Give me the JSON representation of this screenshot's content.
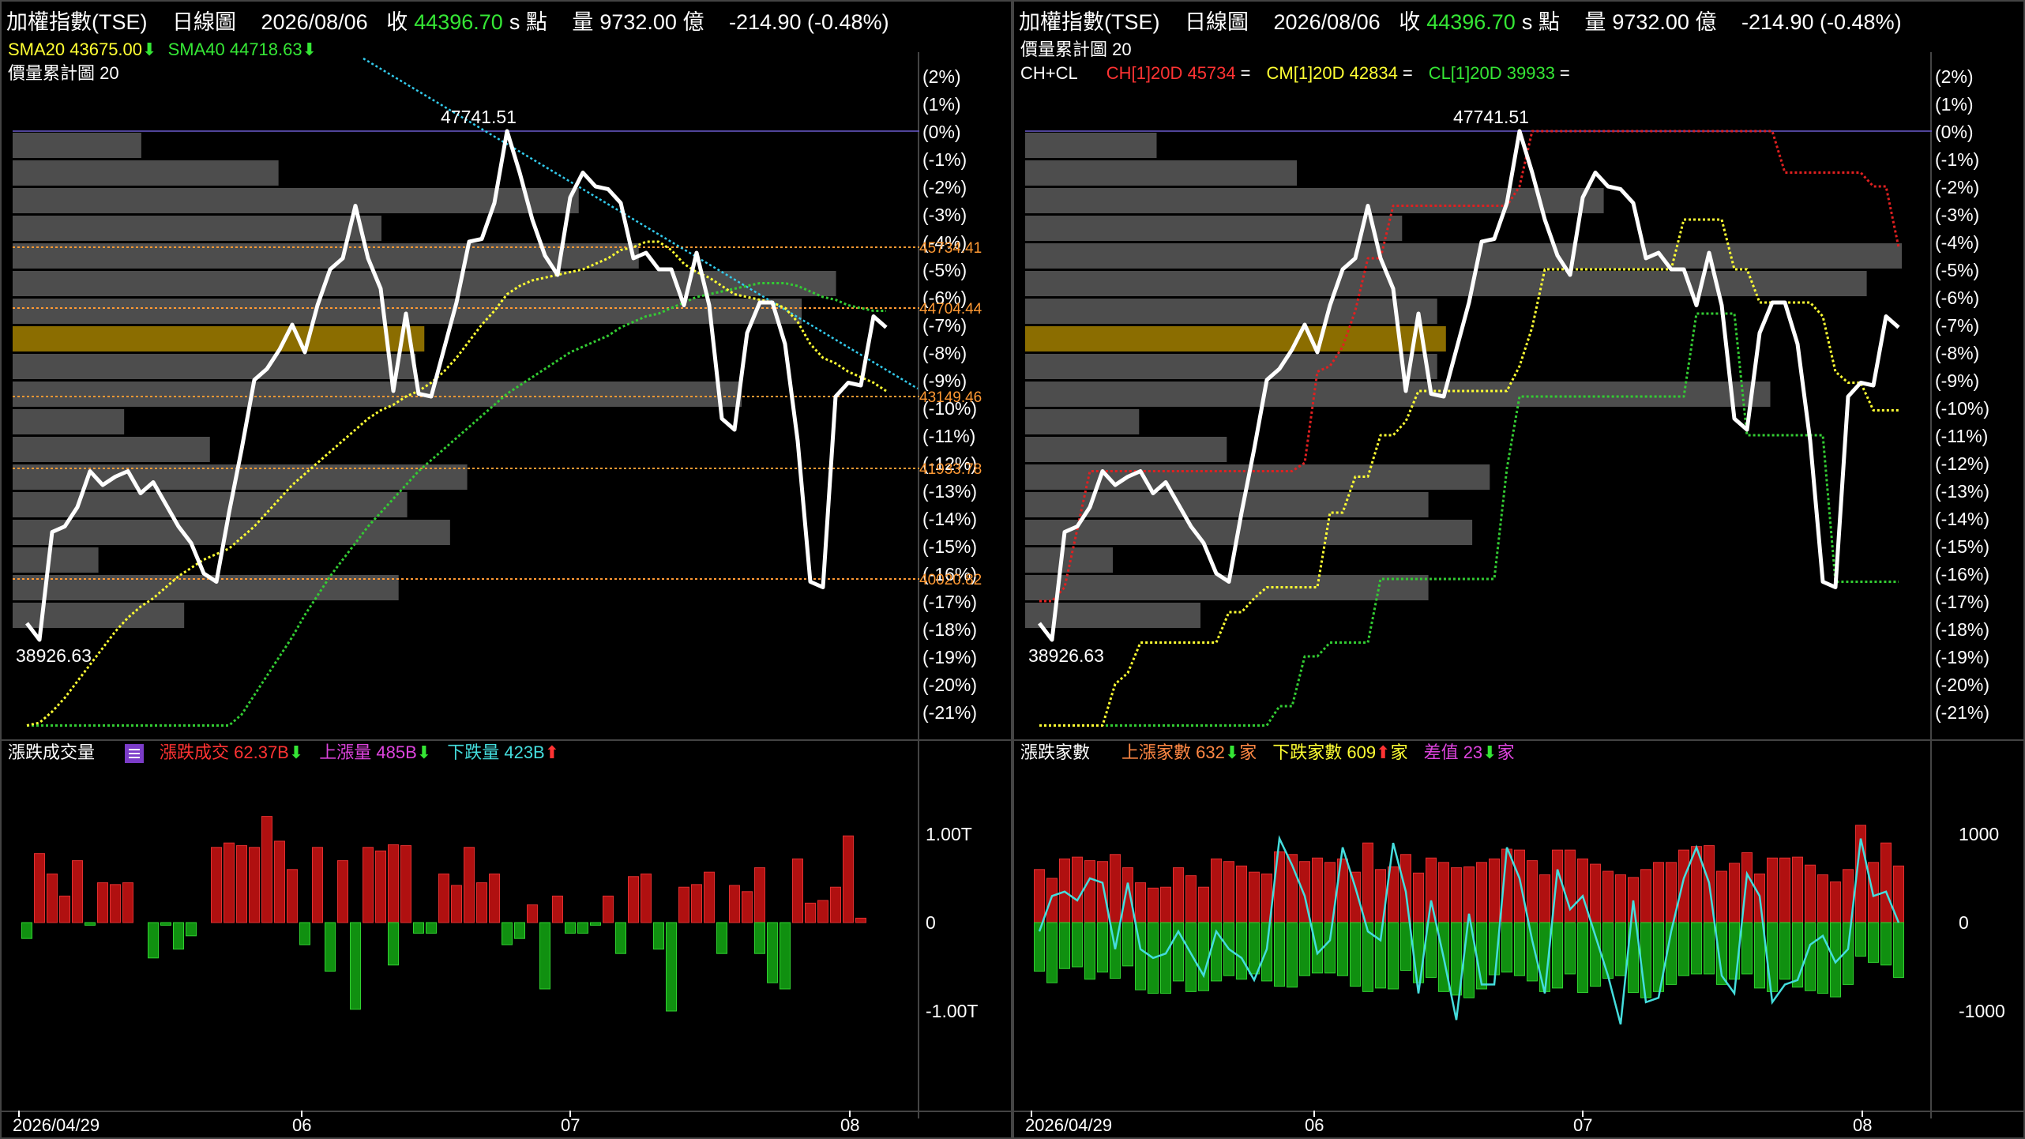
{
  "left": {
    "header": {
      "name": "加權指數(TSE)",
      "period": "日線圖",
      "date": "2026/08/06",
      "close_label": "收",
      "close": "44396.70",
      "unit": "s 點",
      "vol_label": "量",
      "volume": "9732.00 億",
      "change": "-214.90 (-0.48%)"
    },
    "legend": {
      "sma20": "SMA20 43675.00",
      "sma20_arrow": "⬇",
      "sma40": "SMA40 44718.63",
      "sma40_arrow": "⬇",
      "profile": "價量累計圖 20"
    },
    "lower_legend": {
      "title": "漲跌成交量",
      "a": "漲跌成交 62.37B",
      "a_arrow": "⬇",
      "b": "上漲量 485B",
      "b_arrow": "⬇",
      "c": "下跌量 423B",
      "c_arrow": "⬆"
    },
    "levels": [
      "45734.41",
      "44704.44",
      "43149.46",
      "41933.78",
      "40020.82"
    ],
    "lower_ticks": [
      "1.00T",
      "0",
      "-1.00T"
    ]
  },
  "right": {
    "header": {
      "name": "加權指數(TSE)",
      "period": "日線圖",
      "date": "2026/08/06",
      "close_label": "收",
      "close": "44396.70",
      "unit": "s 點",
      "vol_label": "量",
      "volume": "9732.00 億",
      "change": "-214.90 (-0.48%)"
    },
    "legend": {
      "profile": "價量累計圖 20",
      "chcl": "CH+CL",
      "ch": "CH[1]20D 45734",
      "cm": "CM[1]20D 42834",
      "cl": "CL[1]20D 39933",
      "eq": "="
    },
    "lower_legend": {
      "title": "漲跌家數",
      "a": "上漲家數 632",
      "a_arrow": "⬇",
      "a_unit": "家",
      "b": "下跌家數 609",
      "b_arrow": "⬆",
      "b_unit": "家",
      "c": "差值 23",
      "c_arrow": "⬇",
      "c_unit": "家"
    },
    "lower_ticks": [
      "1000",
      "0",
      "-1000"
    ]
  },
  "colors": {
    "price": "#ffffff",
    "sma20": "#ffff33",
    "sma40": "#33cc33",
    "trend": "#33ccee",
    "level": "#ff9933",
    "profile": "#4d4d4d",
    "poc": "#8b6d00",
    "ch": "#e02020",
    "cm": "#ffff33",
    "cl": "#33cc33",
    "up": "#b01010",
    "down": "#109010",
    "diff": "#44dddd"
  },
  "chart_data": [
    {
      "type": "line",
      "panel": "left",
      "x_ticks": [
        "2026/04/29",
        "06",
        "07",
        "08"
      ],
      "y_ticks": [
        "(2%)",
        "(1%)",
        "(0%)",
        "(-1%)",
        "(-2%)",
        "(-3%)",
        "(-4%)",
        "(-5%)",
        "(-6%)",
        "(-7%)",
        "(-8%)",
        "(-9%)",
        "(-10%)",
        "(-11%)",
        "(-12%)",
        "(-13%)",
        "(-14%)",
        "(-15%)",
        "(-16%)",
        "(-17%)",
        "(-18%)",
        "(-19%)",
        "(-20%)",
        "(-21%)"
      ],
      "ylim_pct": [
        -21.5,
        2.5
      ],
      "high_label": "47741.51",
      "low_label": "38926.63",
      "series": [
        {
          "name": "加權指數(TSE)",
          "values": [
            -17.8,
            -18.4,
            -14.5,
            -14.3,
            -13.6,
            -12.3,
            -12.8,
            -12.5,
            -12.3,
            -13.1,
            -12.7,
            -13.5,
            -14.3,
            -14.9,
            -16.0,
            -16.3,
            -13.8,
            -11.5,
            -9.0,
            -8.6,
            -7.9,
            -7.0,
            -8.0,
            -6.3,
            -5.0,
            -4.6,
            -2.7,
            -4.6,
            -5.7,
            -9.4,
            -6.6,
            -9.5,
            -9.6,
            -7.9,
            -6.2,
            -4.0,
            -3.9,
            -2.6,
            -0.0,
            -1.5,
            -3.2,
            -4.5,
            -5.2,
            -2.4,
            -1.5,
            -2.0,
            -2.1,
            -2.6,
            -4.6,
            -4.4,
            -5.0,
            -5.0,
            -6.3,
            -4.4,
            -6.3,
            -10.4,
            -10.8,
            -7.3,
            -6.2,
            -6.2,
            -7.7,
            -11.2,
            -16.3,
            -16.5,
            -9.6,
            -9.1,
            -9.2,
            -6.7,
            -7.1
          ]
        },
        {
          "name": "SMA20",
          "values": [
            -21.5,
            -21.4,
            -21.0,
            -20.5,
            -19.9,
            -19.3,
            -18.7,
            -18.1,
            -17.6,
            -17.2,
            -16.9,
            -16.5,
            -16.1,
            -15.8,
            -15.5,
            -15.3,
            -15.1,
            -14.7,
            -14.3,
            -13.8,
            -13.3,
            -12.8,
            -12.4,
            -12.0,
            -11.6,
            -11.2,
            -10.8,
            -10.4,
            -10.1,
            -9.9,
            -9.6,
            -9.4,
            -9.1,
            -8.7,
            -8.2,
            -7.6,
            -7.0,
            -6.5,
            -5.9,
            -5.6,
            -5.4,
            -5.3,
            -5.2,
            -5.1,
            -5.0,
            -4.8,
            -4.6,
            -4.3,
            -4.2,
            -4.0,
            -4.0,
            -4.3,
            -4.8,
            -5.1,
            -5.3,
            -5.6,
            -5.9,
            -6.0,
            -6.1,
            -6.2,
            -6.4,
            -6.9,
            -7.7,
            -8.2,
            -8.4,
            -8.7,
            -8.9,
            -9.1,
            -9.4
          ]
        },
        {
          "name": "SMA40",
          "values": [
            -21.5,
            -21.5,
            -21.5,
            -21.5,
            -21.5,
            -21.5,
            -21.5,
            -21.5,
            -21.5,
            -21.5,
            -21.5,
            -21.5,
            -21.5,
            -21.5,
            -21.5,
            -21.5,
            -21.5,
            -21.1,
            -20.4,
            -19.7,
            -19.0,
            -18.3,
            -17.5,
            -16.8,
            -16.1,
            -15.5,
            -14.9,
            -14.3,
            -13.8,
            -13.3,
            -12.8,
            -12.3,
            -11.9,
            -11.5,
            -11.1,
            -10.7,
            -10.3,
            -9.9,
            -9.5,
            -9.2,
            -8.9,
            -8.6,
            -8.3,
            -8.0,
            -7.8,
            -7.6,
            -7.4,
            -7.1,
            -6.9,
            -6.7,
            -6.6,
            -6.4,
            -6.2,
            -6.0,
            -5.9,
            -5.8,
            -5.7,
            -5.6,
            -5.5,
            -5.5,
            -5.5,
            -5.6,
            -5.8,
            -6.0,
            -6.1,
            -6.3,
            -6.4,
            -6.5,
            -6.5
          ]
        }
      ],
      "price_levels": [
        45734.41,
        44704.44,
        43149.46,
        41933.78,
        40020.82
      ],
      "level_pct": [
        -4.2,
        -6.4,
        -9.6,
        -12.2,
        -16.2
      ],
      "trendline_pct": [
        [
          35,
          -1.6
        ],
        [
          68,
          -9.2
        ]
      ],
      "profile_bands_pct": [
        [
          0.0,
          -1.0
        ],
        [
          -1.0,
          -2.0
        ],
        [
          -2.0,
          -3.0
        ],
        [
          -3.0,
          -4.0
        ],
        [
          -4.0,
          -5.0
        ],
        [
          -5.0,
          -6.0
        ],
        [
          -6.0,
          -7.0
        ],
        [
          -7.0,
          -8.0
        ],
        [
          -8.0,
          -9.0
        ],
        [
          -9.0,
          -10.0
        ],
        [
          -10.0,
          -11.0
        ],
        [
          -11.0,
          -12.0
        ],
        [
          -12.0,
          -13.0
        ],
        [
          -13.0,
          -14.0
        ],
        [
          -14.0,
          -15.0
        ],
        [
          -15.0,
          -16.0
        ],
        [
          -16.0,
          -17.0
        ],
        [
          -17.0,
          -18.0
        ]
      ],
      "profile_widths": [
        0.15,
        0.31,
        0.66,
        0.43,
        0.73,
        0.96,
        0.92,
        0.48,
        0.47,
        0.85,
        0.13,
        0.23,
        0.53,
        0.46,
        0.51,
        0.1,
        0.45,
        0.2
      ],
      "profile_poc_index": 7
    },
    {
      "type": "bar",
      "panel": "left",
      "name": "漲跌成交量",
      "ylim": [
        -1.35,
        1.35
      ],
      "up": [
        0,
        0.78,
        0.55,
        0.3,
        0.7,
        0,
        0.45,
        0.43,
        0.45,
        0,
        0,
        0,
        0,
        0,
        0,
        0.85,
        0.9,
        0.87,
        0.85,
        1.2,
        0.92,
        0.6,
        0,
        0.85,
        0,
        0.7,
        0,
        0.85,
        0.81,
        0.88,
        0.87,
        0,
        0,
        0.55,
        0.42,
        0.85,
        0.45,
        0.55,
        0,
        0,
        0.2,
        0,
        0.3,
        0,
        0,
        0,
        0.3,
        0,
        0.52,
        0.55,
        0,
        0,
        0.4,
        0.43,
        0.57,
        0,
        0.42,
        0.35,
        0.62,
        0,
        0,
        0.72,
        0.22,
        0.25,
        0.4,
        0.98,
        0.05,
        0,
        0
      ],
      "down": [
        0.18,
        0,
        0,
        0,
        0,
        0.03,
        0,
        0,
        0,
        0,
        0.4,
        0.03,
        0.3,
        0.15,
        0,
        0,
        0,
        0,
        0,
        0,
        0,
        0,
        0.25,
        0,
        0.55,
        0,
        0.98,
        0,
        0,
        0.48,
        0,
        0.12,
        0.12,
        0,
        0,
        0,
        0,
        0,
        0.25,
        0.18,
        0,
        0.75,
        0,
        0.12,
        0.12,
        0.03,
        0,
        0.35,
        0,
        0,
        0.3,
        1.0,
        0,
        0,
        0,
        0.35,
        0,
        0,
        0.35,
        0.68,
        0.75,
        0,
        0,
        0,
        0,
        0,
        0,
        0,
        0
      ]
    },
    {
      "type": "line",
      "panel": "right",
      "series": [
        {
          "name": "CH[1]20D",
          "values": [
            -17.0,
            -17.0,
            -16.5,
            -14.4,
            -12.3,
            -12.3,
            -12.3,
            -12.3,
            -12.3,
            -12.3,
            -12.3,
            -12.3,
            -12.3,
            -12.3,
            -12.3,
            -12.3,
            -12.3,
            -12.3,
            -12.3,
            -12.3,
            -12.3,
            -12.0,
            -8.7,
            -8.5,
            -7.8,
            -6.5,
            -4.6,
            -4.6,
            -2.7,
            -2.7,
            -2.7,
            -2.7,
            -2.7,
            -2.7,
            -2.7,
            -2.7,
            -2.7,
            -2.7,
            -2.0,
            0.0,
            0.0,
            0.0,
            0.0,
            0.0,
            0.0,
            0.0,
            0.0,
            0.0,
            0.0,
            0.0,
            0.0,
            0.0,
            0.0,
            0.0,
            0.0,
            0.0,
            0.0,
            0.0,
            0.0,
            -1.5,
            -1.5,
            -1.5,
            -1.5,
            -1.5,
            -1.5,
            -1.5,
            -2.0,
            -2.0,
            -4.2
          ]
        },
        {
          "name": "CM[1]20D",
          "values": [
            -21.5,
            -21.5,
            -21.5,
            -21.5,
            -21.5,
            -21.5,
            -20.0,
            -19.6,
            -18.5,
            -18.5,
            -18.5,
            -18.5,
            -18.5,
            -18.5,
            -18.5,
            -17.4,
            -17.4,
            -16.9,
            -16.5,
            -16.5,
            -16.5,
            -16.5,
            -16.5,
            -13.8,
            -13.8,
            -12.5,
            -12.5,
            -11.0,
            -11.0,
            -10.5,
            -9.4,
            -9.4,
            -9.4,
            -9.4,
            -9.4,
            -9.4,
            -9.4,
            -9.4,
            -8.5,
            -7.1,
            -5.0,
            -5.0,
            -5.0,
            -5.0,
            -5.0,
            -5.0,
            -5.0,
            -5.0,
            -5.0,
            -5.0,
            -5.0,
            -3.2,
            -3.2,
            -3.2,
            -3.2,
            -5.0,
            -5.0,
            -6.2,
            -6.2,
            -6.2,
            -6.2,
            -6.2,
            -6.7,
            -8.7,
            -9.1,
            -9.1,
            -10.1,
            -10.1,
            -10.1
          ]
        },
        {
          "name": "CL[1]20D",
          "values": [
            -21.5,
            -21.5,
            -21.5,
            -21.5,
            -21.5,
            -21.5,
            -21.5,
            -21.5,
            -21.5,
            -21.5,
            -21.5,
            -21.5,
            -21.5,
            -21.5,
            -21.5,
            -21.5,
            -21.5,
            -21.5,
            -21.5,
            -20.8,
            -20.8,
            -19.0,
            -19.0,
            -18.5,
            -18.5,
            -18.5,
            -18.5,
            -16.2,
            -16.2,
            -16.2,
            -16.2,
            -16.2,
            -16.2,
            -16.2,
            -16.2,
            -16.2,
            -16.2,
            -12.2,
            -9.6,
            -9.6,
            -9.6,
            -9.6,
            -9.6,
            -9.6,
            -9.6,
            -9.6,
            -9.6,
            -9.6,
            -9.6,
            -9.6,
            -9.6,
            -9.6,
            -6.6,
            -6.6,
            -6.6,
            -6.6,
            -11.0,
            -11.0,
            -11.0,
            -11.0,
            -11.0,
            -11.0,
            -11.0,
            -16.3,
            -16.3,
            -16.3,
            -16.3,
            -16.3,
            -16.3
          ]
        }
      ],
      "profile_widths": [
        0.15,
        0.31,
        0.66,
        0.43,
        1.0,
        0.96,
        0.47,
        0.48,
        0.47,
        0.85,
        0.13,
        0.23,
        0.53,
        0.46,
        0.51,
        0.1,
        0.46,
        0.2
      ],
      "profile_poc_index": 7
    },
    {
      "type": "bar",
      "panel": "right",
      "name": "漲跌家數",
      "ylim": [
        -1250,
        1250
      ],
      "up": [
        600,
        500,
        720,
        740,
        700,
        690,
        770,
        620,
        450,
        390,
        400,
        620,
        530,
        400,
        720,
        690,
        640,
        570,
        550,
        800,
        770,
        690,
        730,
        680,
        720,
        570,
        900,
        600,
        630,
        770,
        560,
        730,
        680,
        620,
        630,
        680,
        720,
        830,
        820,
        700,
        540,
        820,
        820,
        720,
        660,
        580,
        540,
        510,
        600,
        680,
        680,
        820,
        860,
        870,
        580,
        670,
        790,
        550,
        730,
        730,
        740,
        650,
        540,
        460,
        600,
        1100,
        680,
        900,
        640
      ],
      "down": [
        550,
        680,
        520,
        500,
        640,
        560,
        630,
        490,
        760,
        800,
        800,
        660,
        780,
        770,
        660,
        600,
        640,
        580,
        660,
        720,
        730,
        600,
        570,
        570,
        600,
        720,
        780,
        740,
        750,
        540,
        680,
        620,
        780,
        820,
        850,
        750,
        590,
        560,
        600,
        660,
        780,
        740,
        580,
        790,
        720,
        630,
        600,
        790,
        850,
        780,
        700,
        600,
        580,
        580,
        700,
        640,
        580,
        740,
        780,
        640,
        730,
        770,
        800,
        840,
        700,
        380,
        450,
        480,
        620
      ],
      "diff": [
        -100,
        300,
        350,
        250,
        500,
        450,
        -300,
        450,
        -300,
        -400,
        -350,
        -100,
        -350,
        -600,
        -100,
        -300,
        -400,
        -650,
        -300,
        950,
        650,
        300,
        -350,
        -200,
        850,
        400,
        -100,
        -200,
        900,
        350,
        -800,
        250,
        -400,
        -1100,
        100,
        -700,
        -700,
        850,
        500,
        -200,
        -800,
        600,
        150,
        300,
        -150,
        -600,
        -1150,
        250,
        -900,
        -850,
        -100,
        500,
        850,
        450,
        -600,
        -800,
        550,
        300,
        -900,
        -700,
        -650,
        -250,
        -150,
        -450,
        -300,
        950,
        300,
        350,
        0
      ]
    }
  ]
}
